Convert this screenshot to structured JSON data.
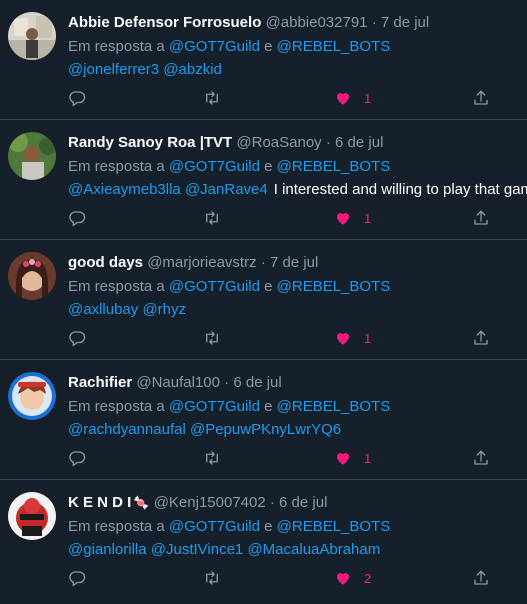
{
  "tweets": [
    {
      "name": "Abbie Defensor Forrosuelo",
      "handle": "@abbie032791",
      "date": "7 de jul",
      "reply_prefix": "Em resposta a",
      "reply_to_1": "@GOT7Guild",
      "reply_and": "e",
      "reply_to_2": "@REBEL_BOTS",
      "mentions": [
        "@jonelferrer3",
        "@abzkid"
      ],
      "text": "",
      "likes": "1"
    },
    {
      "name": "Randy Sanoy Roa |TVT",
      "handle": "@RoaSanoy",
      "date": "6 de jul",
      "reply_prefix": "Em resposta a",
      "reply_to_1": "@GOT7Guild",
      "reply_and": "e",
      "reply_to_2": "@REBEL_BOTS",
      "mentions": [
        "@Axieaymeb3lla",
        "@JanRave4"
      ],
      "text": "I interested and willing to play that gam",
      "likes": "1"
    },
    {
      "name": "good days",
      "handle": "@marjorieavstrz",
      "date": "7 de jul",
      "reply_prefix": "Em resposta a",
      "reply_to_1": "@GOT7Guild",
      "reply_and": "e",
      "reply_to_2": "@REBEL_BOTS",
      "mentions": [
        "@axllubay",
        "@rhyz"
      ],
      "text": "",
      "likes": "1"
    },
    {
      "name": "Rachifier",
      "handle": "@Naufal100",
      "date": "6 de jul",
      "reply_prefix": "Em resposta a",
      "reply_to_1": "@GOT7Guild",
      "reply_and": "e",
      "reply_to_2": "@REBEL_BOTS",
      "mentions": [
        "@rachdyannaufal",
        "@PepuwPKnyLwrYQ6"
      ],
      "text": "",
      "likes": "1"
    },
    {
      "name": "K E N D I",
      "name_emoji": "🍬",
      "handle": "@Kenj15007402",
      "date": "6 de jul",
      "reply_prefix": "Em resposta a",
      "reply_to_1": "@GOT7Guild",
      "reply_and": "e",
      "reply_to_2": "@REBEL_BOTS",
      "mentions": [
        "@gianlorilla",
        "@JustIVince1",
        "@MacaluaAbraham"
      ],
      "text": "",
      "likes": "2"
    }
  ],
  "separator_dot": "·",
  "icons": {
    "reply": "reply-icon",
    "retweet": "retweet-icon",
    "like": "heart-filled-icon",
    "share": "share-icon"
  },
  "colors": {
    "background": "#15202b",
    "link": "#1d9bf0",
    "like": "#f91880",
    "muted": "#8b98a5"
  }
}
